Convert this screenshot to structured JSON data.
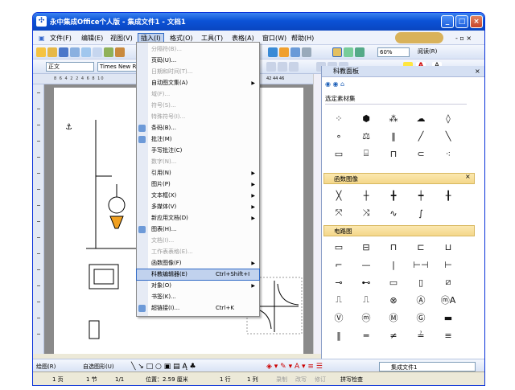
{
  "window": {
    "title": "永中集成Office个人版 - 集成文件1 - 文档1"
  },
  "menubar": [
    {
      "label": "文件(F)"
    },
    {
      "label": "编辑(E)"
    },
    {
      "label": "视图(V)"
    },
    {
      "label": "插入(I)"
    },
    {
      "label": "格式(O)"
    },
    {
      "label": "工具(T)"
    },
    {
      "label": "表格(A)"
    },
    {
      "label": "窗口(W)"
    },
    {
      "label": "帮助(H)"
    }
  ],
  "toolbar": {
    "style_value": "正文",
    "font_value": "Times New R",
    "zoom_value": "60%",
    "read_label": "阅读(R)"
  },
  "ruler": "8 6 4 2   2 4 6 8 10",
  "ruler_right": "42  44  46",
  "insert_menu": [
    {
      "label": "分隔符(B)...",
      "disabled": true
    },
    {
      "label": "页码(U)...",
      "disabled": false
    },
    {
      "label": "日期和时间(T)...",
      "disabled": true
    },
    {
      "label": "自动图文集(A)",
      "disabled": false,
      "arrow": "▶"
    },
    {
      "label": "域(F)...",
      "disabled": true
    },
    {
      "label": "符号(S)...",
      "disabled": true
    },
    {
      "label": "特殊符号(I)...",
      "disabled": true
    },
    {
      "label": "条码(B)...",
      "disabled": false,
      "icon": true
    },
    {
      "label": "批注(M)",
      "disabled": false,
      "icon": true
    },
    {
      "label": "手写批注(C)",
      "disabled": false
    },
    {
      "label": "数字(N)...",
      "disabled": true
    },
    {
      "label": "引用(N)",
      "disabled": false,
      "arrow": "▶"
    },
    {
      "label": "图片(P)",
      "disabled": false,
      "arrow": "▶"
    },
    {
      "label": "文本框(X)",
      "disabled": false,
      "arrow": "▶"
    },
    {
      "label": "多媒体(V)",
      "disabled": false,
      "arrow": "▶"
    },
    {
      "label": "新应用文档(D)",
      "disabled": false,
      "arrow": "▶"
    },
    {
      "label": "图表(H)...",
      "disabled": false,
      "icon": true
    },
    {
      "label": "文档(I)...",
      "disabled": true
    },
    {
      "label": "工作表表格(E)...",
      "disabled": true
    },
    {
      "label": "函数图像(F)",
      "disabled": false,
      "arrow": "▶"
    },
    {
      "label": "科教编辑器(E)",
      "disabled": false,
      "shortcut": "Ctrl+Shift+I",
      "highlight": true
    },
    {
      "label": "对象(O)",
      "disabled": false,
      "arrow": "▶"
    },
    {
      "label": "书签(K)...",
      "disabled": false
    },
    {
      "label": "超链接(I)...",
      "disabled": false,
      "shortcut": "Ctrl+K",
      "icon": true
    }
  ],
  "pane": {
    "title": "科教面板",
    "selector": "选定素材集",
    "group1": "函数图像",
    "group2": "电路图",
    "group1_close": "×",
    "row_a": [
      "⁘",
      "⬢",
      "⁂",
      "☁",
      "◊"
    ],
    "row_b": [
      "∘",
      "⚖",
      "‖",
      "╱",
      "╲"
    ],
    "row_c": [
      "▭",
      "⌸",
      "⊓",
      "⊂",
      "⁖"
    ],
    "func_a": [
      "╳",
      "┼",
      "╋",
      "┿",
      "╂"
    ],
    "func_b": [
      "⤧",
      "⤨",
      "∿",
      "∫",
      ""
    ],
    "circ_a": [
      "▭",
      "⊟",
      "⊓",
      "⊏",
      "⊔"
    ],
    "circ_b": [
      "⌐",
      "—",
      "|",
      "⊢⊣",
      "⊢"
    ],
    "circ_c": [
      "⊸",
      "⊷",
      "▭",
      "▯",
      "⧄"
    ],
    "circ_d": [
      "⎍",
      "⎍",
      "⊗",
      "Ⓐ",
      "ⓜA"
    ],
    "circ_e": [
      "Ⓥ",
      "ⓜ",
      "Ⓜ",
      "Ⓖ",
      "▬"
    ],
    "circ_f": [
      "‖",
      "═",
      "≠",
      "≟",
      "≡"
    ]
  },
  "drawbar": {
    "draw_label": "绘图(R)",
    "autoshape_label": "自选图形(U)"
  },
  "taskbar": {
    "file_label": "集成文件1"
  },
  "status": {
    "page": "1 页",
    "section": "1 节",
    "pages": "1/1",
    "position": "位置：2.59 厘米",
    "line": "1 行",
    "col": "1 列",
    "rec": "录制",
    "rev": "改写",
    "ext": "修订",
    "spell": "拼写检查"
  }
}
